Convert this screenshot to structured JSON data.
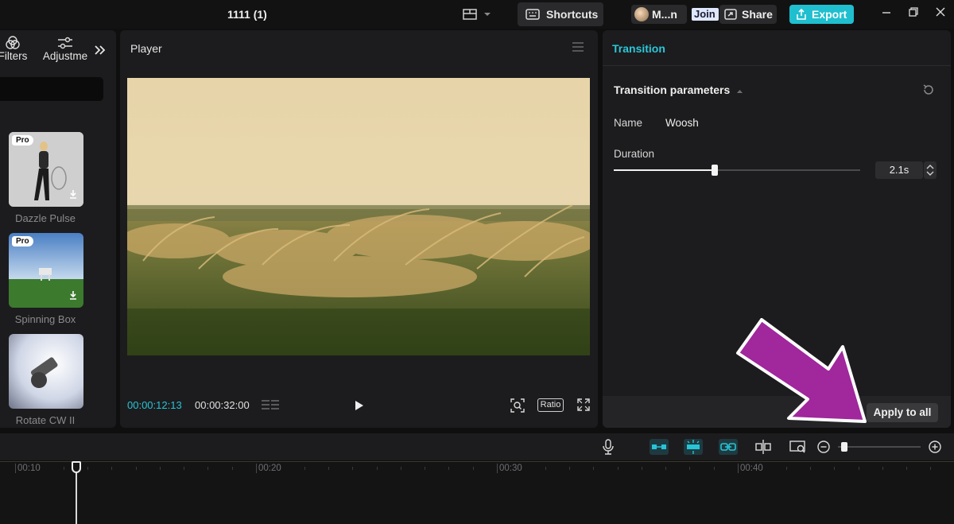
{
  "window": {
    "title": "1111 (1)",
    "shortcuts_label": "Shortcuts",
    "user_name": "M...n",
    "join_label": "Join",
    "share_label": "Share",
    "export_label": "Export"
  },
  "left_panel": {
    "tabs": [
      {
        "label": "Filters"
      },
      {
        "label": "Adjustme"
      }
    ],
    "expand_icon": "double-chevron-right-icon",
    "items": [
      {
        "label": "Dazzle Pulse",
        "pro": "Pro"
      },
      {
        "label": "Spinning Box",
        "pro": "Pro"
      },
      {
        "label": "Rotate CW II"
      }
    ]
  },
  "player": {
    "title": "Player",
    "current_time": "00:00:12:13",
    "total_time": "00:00:32:00",
    "ratio_label": "Ratio"
  },
  "transition": {
    "tab_label": "Transition",
    "section_label": "Transition parameters",
    "name_label": "Name",
    "name_value": "Woosh",
    "duration_label": "Duration",
    "duration_value": "2.1s",
    "duration_fraction": 0.41,
    "apply_all_label": "Apply to all"
  },
  "timeline": {
    "labels": [
      "00:10",
      "00:20",
      "00:30",
      "00:40"
    ],
    "zoom_level": 0.08
  },
  "colors": {
    "accent": "#1fbfcf",
    "annotation_arrow": "#a0279c"
  }
}
